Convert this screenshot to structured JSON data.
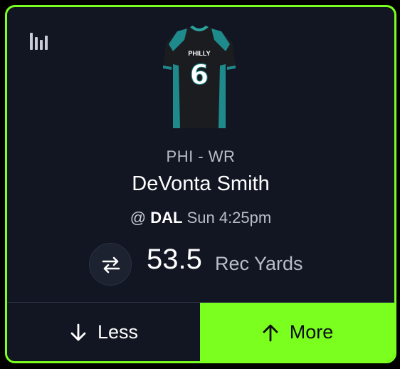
{
  "card": {
    "stats_icon": "bar-chart-icon",
    "jersey": {
      "icon": "jersey-icon",
      "team_text": "PHILLY",
      "number": "6",
      "colors": {
        "body": "#1b1c1f",
        "accent": "#1f8a8c",
        "collar": "#2aa39f",
        "text": "#ffffff"
      }
    },
    "team_position": "PHI - WR",
    "player_name": "DeVonta Smith",
    "matchup": {
      "at": "@",
      "opponent": "DAL",
      "time": "Sun 4:25pm"
    },
    "swap_icon": "swap-arrows-icon",
    "line_value": "53.5",
    "stat_label": "Rec Yards"
  },
  "actions": {
    "less": {
      "label": "Less",
      "icon": "arrow-down-icon"
    },
    "more": {
      "label": "More",
      "icon": "arrow-up-icon"
    }
  },
  "colors": {
    "accent": "#7bff1e",
    "card_bg": "#121623",
    "muted_text": "#b8bdc8"
  }
}
